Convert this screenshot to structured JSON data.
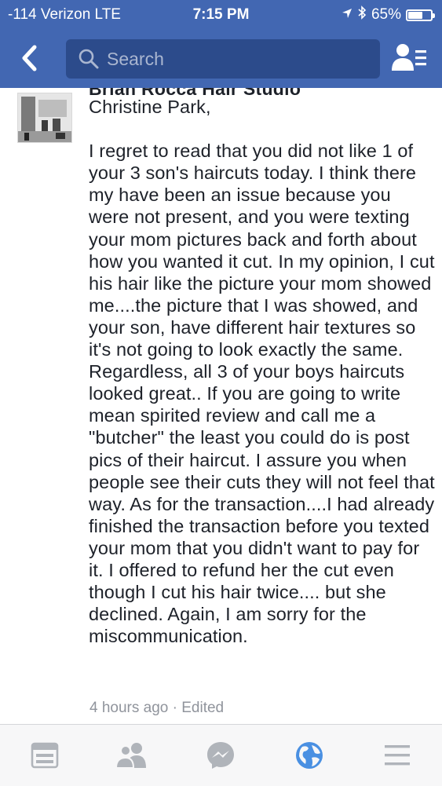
{
  "status_bar": {
    "carrier": "-114 Verizon  LTE",
    "time": "7:15 PM",
    "battery": "65%",
    "battery_level": 0.65
  },
  "nav": {
    "search_placeholder": "Search"
  },
  "post": {
    "author": "Brian Rocca Hair Studio",
    "text": "Christine Park,\n\nI regret to read that you did not like 1 of your 3 son's haircuts today.  I think there my have been an issue because you were not present, and you were texting your mom pictures back and forth about how you wanted it cut. In my opinion, I cut his hair like the picture your mom showed me....the picture that I was showed,  and your son, have different hair textures so it's not going to look exactly the same. Regardless, all 3 of your boys haircuts looked great.. If you are going to write mean spirited review and call me a \"butcher\" the least you could do is post pics of their haircut. I assure you when people see their cuts they will not feel that way.  As for the transaction....I had already finished the transaction before you texted your mom that you didn't want to pay for it.  I offered to refund her the cut even though I cut his hair twice.... but she declined. Again, I am sorry for the miscommunication.",
    "time_ago": "4 hours ago",
    "separator": "·",
    "edited": "Edited"
  },
  "tabs": [
    {
      "name": "news-feed",
      "icon": "news-feed-icon"
    },
    {
      "name": "friend-requests",
      "icon": "friends-icon"
    },
    {
      "name": "messenger",
      "icon": "messenger-icon"
    },
    {
      "name": "notifications",
      "icon": "globe-icon",
      "active": true
    },
    {
      "name": "more",
      "icon": "menu-icon"
    }
  ],
  "colors": {
    "header": "#4267b2",
    "search_bg": "#2c4b8b",
    "text": "#1d2129",
    "meta": "#90949c",
    "tab_inactive": "#b0b4ba",
    "tab_active": "#4a90e2"
  }
}
